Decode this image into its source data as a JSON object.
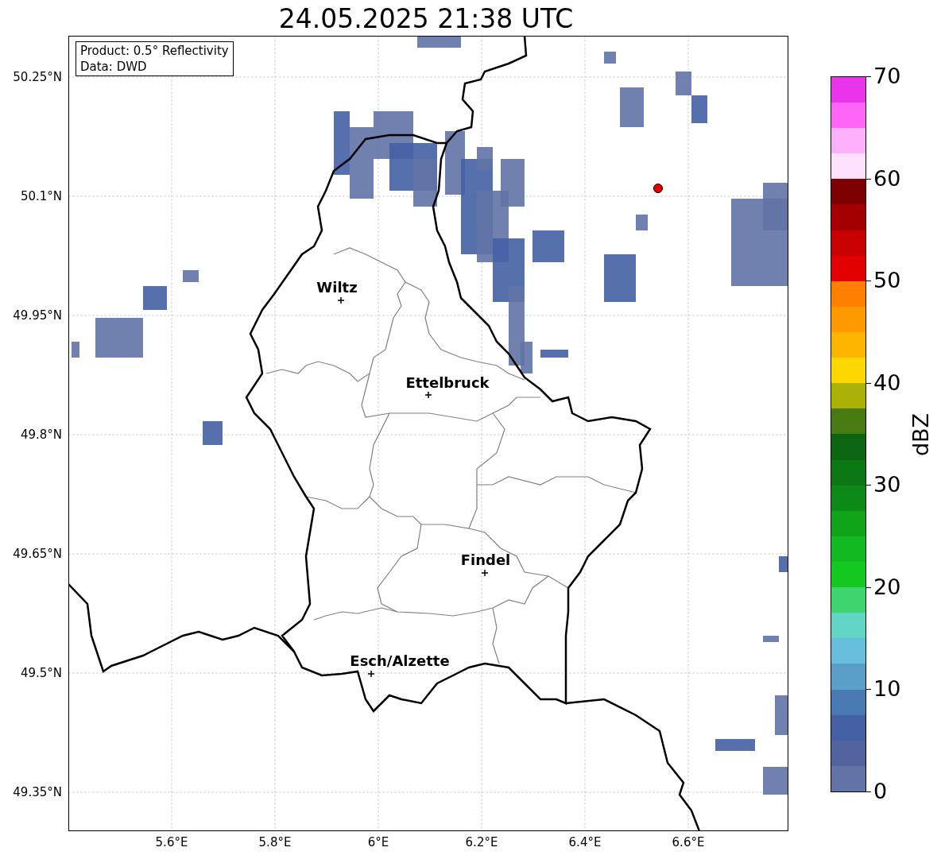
{
  "title": "24.05.2025 21:38 UTC",
  "info_box": [
    "Product: 0.5° Reflectivity",
    "Data: DWD"
  ],
  "y_ticks": [
    "50.25°N",
    "50.1°N",
    "49.95°N",
    "49.8°N",
    "49.65°N",
    "49.5°N",
    "49.35°N"
  ],
  "x_ticks": [
    "5.6°E",
    "5.8°E",
    "6°E",
    "6.2°E",
    "6.4°E",
    "6.6°E"
  ],
  "cities": [
    "Wiltz",
    "Ettelbruck",
    "Findel",
    "Esch/Alzette"
  ],
  "colorbar": {
    "label": "dBZ",
    "ticks": [
      "70",
      "60",
      "50",
      "40",
      "30",
      "20",
      "10",
      "0"
    ],
    "segments": [
      {
        "color": "#6273a6"
      },
      {
        "color": "#5164a0"
      },
      {
        "color": "#4461a5"
      },
      {
        "color": "#4a7ab3"
      },
      {
        "color": "#5a9fc9"
      },
      {
        "color": "#67bfdd"
      },
      {
        "color": "#62d6c6"
      },
      {
        "color": "#3dd46e"
      },
      {
        "color": "#13c81f"
      },
      {
        "color": "#12b921"
      },
      {
        "color": "#10a418"
      },
      {
        "color": "#0d8918"
      },
      {
        "color": "#0c7814"
      },
      {
        "color": "#0a6611"
      },
      {
        "color": "#477a10"
      },
      {
        "color": "#acb107"
      },
      {
        "color": "#ffd700"
      },
      {
        "color": "#ffb400"
      },
      {
        "color": "#ff9900"
      },
      {
        "color": "#ff7f00"
      },
      {
        "color": "#e30000"
      },
      {
        "color": "#c80000"
      },
      {
        "color": "#a50000"
      },
      {
        "color": "#7f0000"
      },
      {
        "color": "#ffe1fd"
      },
      {
        "color": "#ffb0fc"
      },
      {
        "color": "#ff66f8"
      },
      {
        "color": "#e934ec"
      }
    ]
  }
}
